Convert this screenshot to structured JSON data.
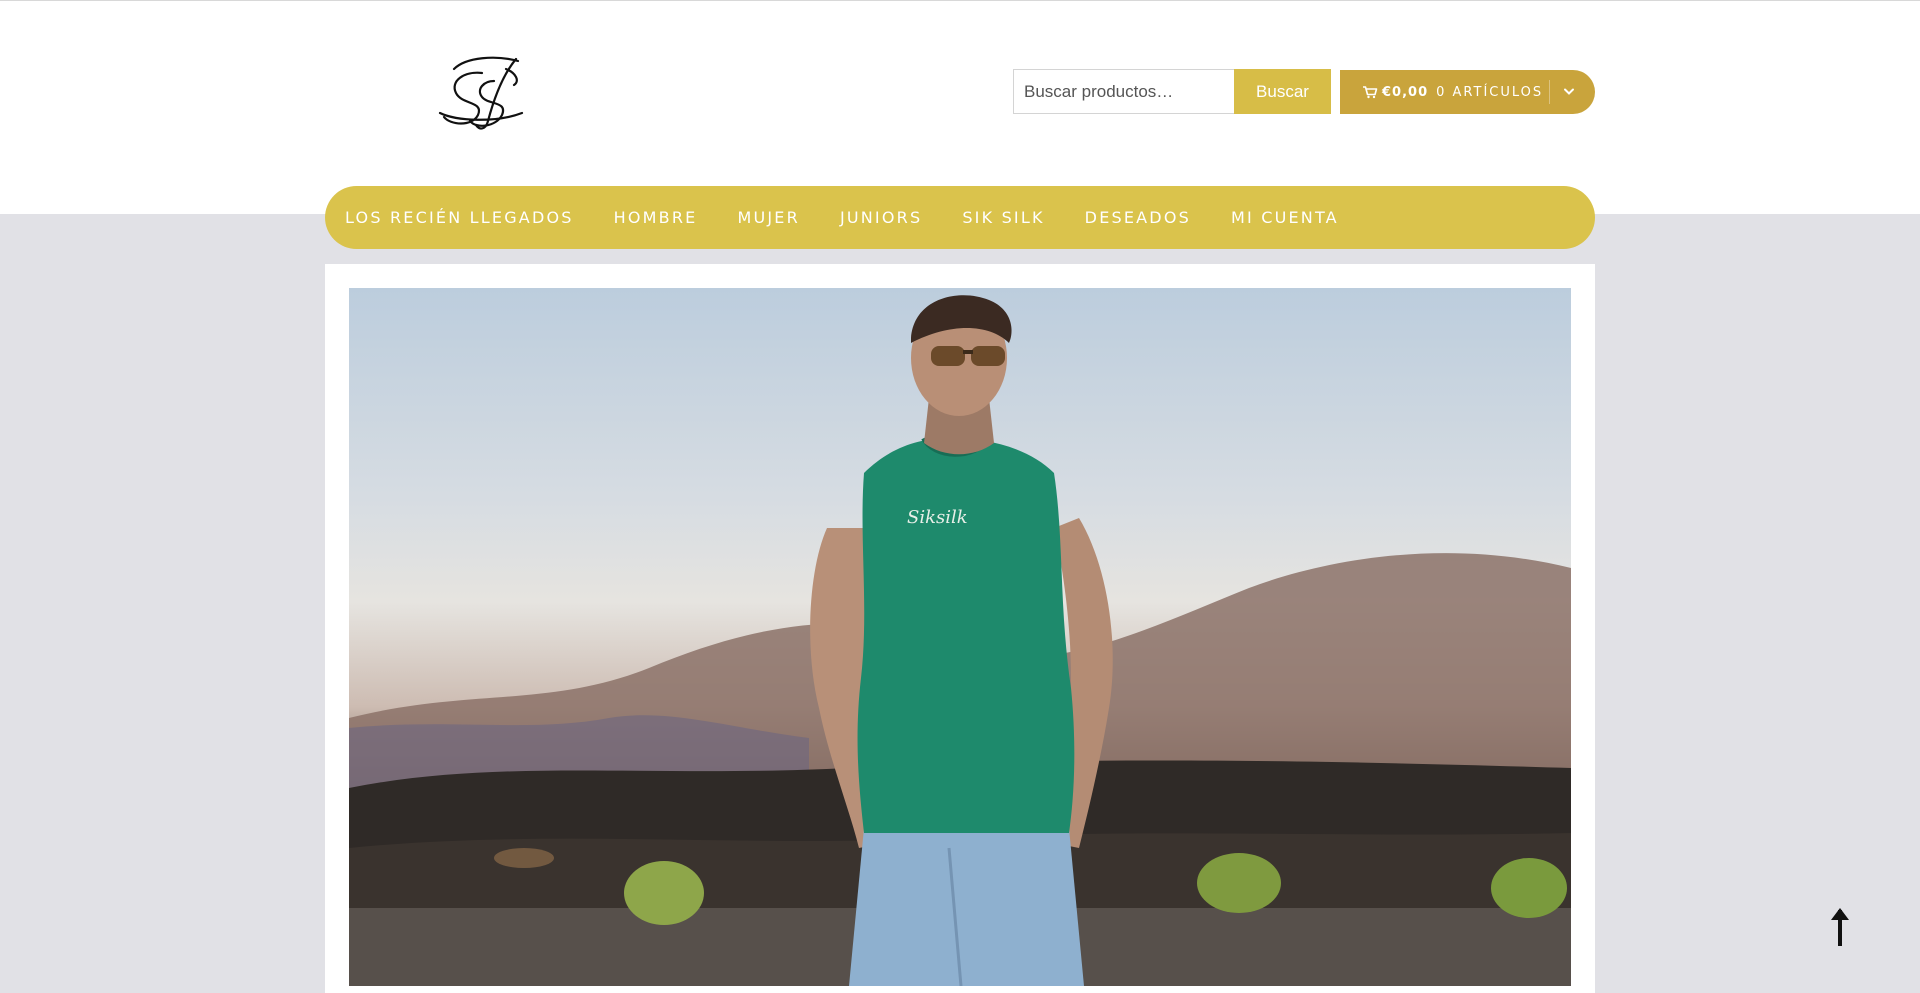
{
  "header": {
    "logo_icon": "siksilk-monogram-logo",
    "search": {
      "placeholder": "Buscar productos…",
      "button_label": "Buscar"
    },
    "cart": {
      "total": "€0,00",
      "count_label": "0 ARTÍCULOS",
      "icon": "cart-icon",
      "dropdown_icon": "chevron-down-icon"
    }
  },
  "nav": {
    "items": [
      {
        "label": "LOS RECIÉN LLEGADOS"
      },
      {
        "label": "HOMBRE"
      },
      {
        "label": "MUJER"
      },
      {
        "label": "JUNIORS"
      },
      {
        "label": "SIK SILK"
      },
      {
        "label": "DESEADOS"
      },
      {
        "label": "MI CUENTA"
      }
    ]
  },
  "hero": {
    "image": "model-in-green-sleeveless-tshirt-desert-landscape"
  },
  "back_to_top": {
    "icon": "arrow-up-icon"
  },
  "colors": {
    "accent": "#dac34c",
    "accent_dark": "#c9a43c",
    "background": "#e1e1e6"
  }
}
